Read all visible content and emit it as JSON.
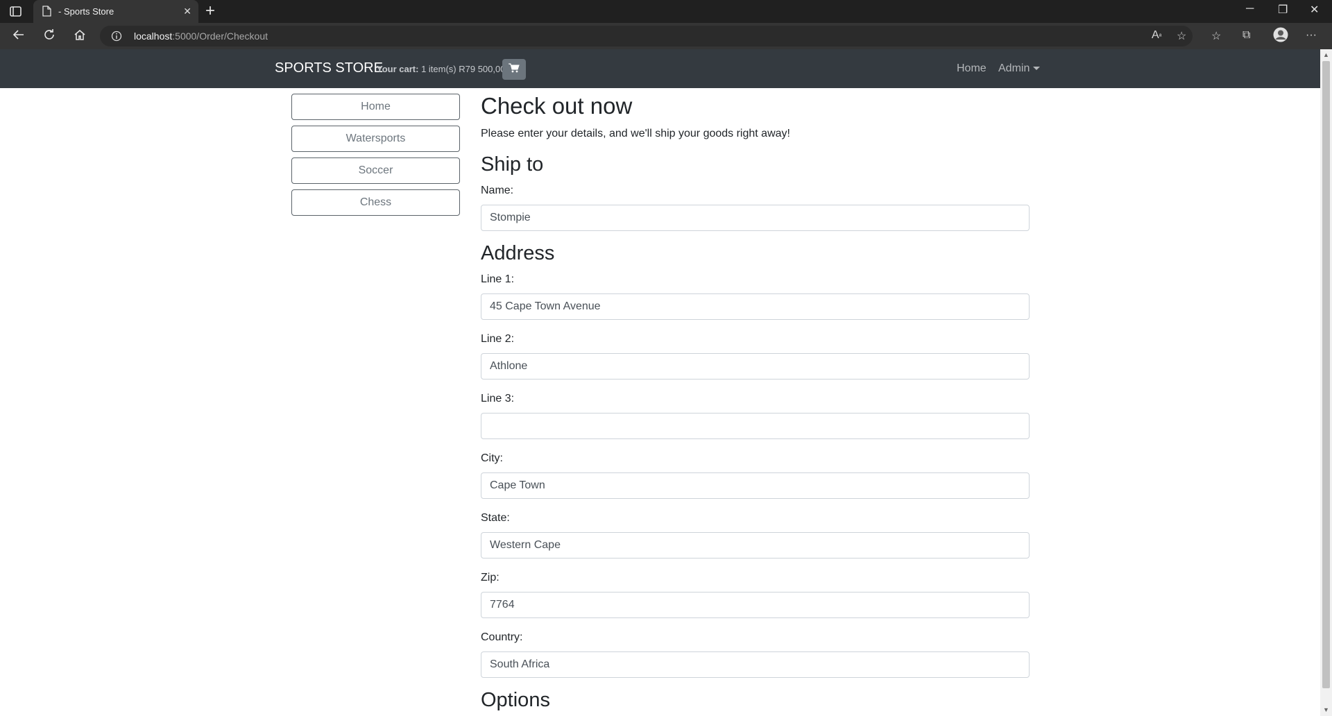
{
  "browser": {
    "tab_title": "- Sports Store",
    "url_host": "localhost",
    "url_rest": ":5000/Order/Checkout"
  },
  "navbar": {
    "brand": "SPORTS STORE",
    "cart_label": "Your cart:",
    "cart_summary": "1 item(s) R79 500,00",
    "links": [
      "Home",
      "Admin"
    ]
  },
  "sidebar": {
    "categories": [
      "Home",
      "Watersports",
      "Soccer",
      "Chess"
    ]
  },
  "main": {
    "title": "Check out now",
    "lead": "Please enter your details, and we'll ship your goods right away!",
    "ship_heading": "Ship to",
    "address_heading": "Address",
    "options_heading": "Options",
    "fields": {
      "name": {
        "label": "Name:",
        "value": "Stompie"
      },
      "line1": {
        "label": "Line 1:",
        "value": "45 Cape Town Avenue"
      },
      "line2": {
        "label": "Line 2:",
        "value": "Athlone"
      },
      "line3": {
        "label": "Line 3:",
        "value": ""
      },
      "city": {
        "label": "City:",
        "value": "Cape Town"
      },
      "state": {
        "label": "State:",
        "value": "Western Cape"
      },
      "zip": {
        "label": "Zip:",
        "value": "7764"
      },
      "country": {
        "label": "Country:",
        "value": "South Africa"
      }
    }
  },
  "colors": {
    "navbar_bg": "#343a40",
    "cart_button_bg": "#6c757d",
    "category_border": "#5a6268"
  }
}
